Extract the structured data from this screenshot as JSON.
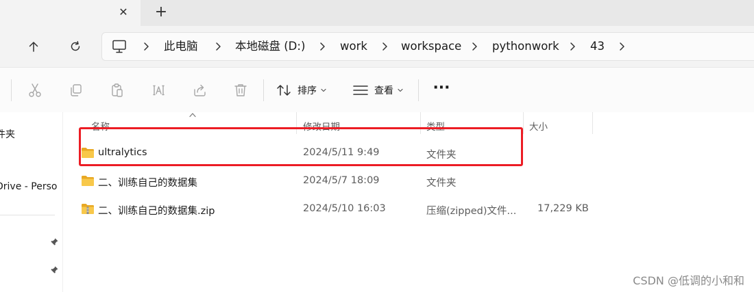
{
  "tabbar": {
    "close_label": "✕",
    "new_tab_label": "+"
  },
  "breadcrumb": [
    {
      "label": "此电脑"
    },
    {
      "label": "本地磁盘 (D:)"
    },
    {
      "label": "work"
    },
    {
      "label": "workspace"
    },
    {
      "label": "pythonwork"
    },
    {
      "label": "43"
    }
  ],
  "toolbar": {
    "sort_label": "排序",
    "view_label": "查看",
    "more_label": "···"
  },
  "sidebar": {
    "items": [
      {
        "label": "件夹"
      },
      {
        "label": "Drive - Perso"
      }
    ]
  },
  "columns": {
    "name": "名称",
    "date": "修改日期",
    "type": "类型",
    "size": "大小"
  },
  "files": [
    {
      "name": "ultralytics",
      "date": "2024/5/11 9:49",
      "type": "文件夹",
      "size": "",
      "icon": "folder-icon"
    },
    {
      "name": "二、训练自己的数据集",
      "date": "2024/5/7 18:09",
      "type": "文件夹",
      "size": "",
      "icon": "folder-icon"
    },
    {
      "name": "二、训练自己的数据集.zip",
      "date": "2024/5/10 16:03",
      "type": "压缩(zipped)文件...",
      "size": "17,229 KB",
      "icon": "zip-folder-icon"
    }
  ],
  "watermark": "CSDN @低调的小和和",
  "colors": {
    "highlight": "#ec1c24",
    "folder": "#f8c84a"
  }
}
